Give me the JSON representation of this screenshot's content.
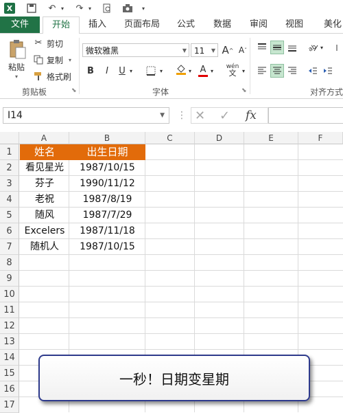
{
  "app": {
    "logo_letter": "X"
  },
  "tabs": [
    "文件",
    "开始",
    "插入",
    "页面布局",
    "公式",
    "数据",
    "审阅",
    "视图",
    "美化"
  ],
  "ribbon": {
    "clipboard": {
      "paste": "粘贴",
      "cut": "剪切",
      "copy": "复制",
      "format_painter": "格式刷",
      "group_label": "剪贴板"
    },
    "font": {
      "font_name": "微软雅黑",
      "font_size": "11",
      "bold": "B",
      "italic": "I",
      "underline": "U",
      "grow": "A",
      "shrink": "A",
      "color_a": "A",
      "phonetic": "wén",
      "group_label": "字体"
    },
    "alignment": {
      "group_label": "对齐方式"
    }
  },
  "formula_bar": {
    "name_box": "I14",
    "fx": "fx"
  },
  "columns": [
    "A",
    "B",
    "C",
    "D",
    "E",
    "F"
  ],
  "rows": [
    "1",
    "2",
    "3",
    "4",
    "5",
    "6",
    "7",
    "8",
    "9",
    "10",
    "11",
    "12",
    "13",
    "14",
    "15",
    "16",
    "17"
  ],
  "table": {
    "headers": [
      "姓名",
      "出生日期"
    ],
    "rows": [
      [
        "看见星光",
        "1987/10/15"
      ],
      [
        "芬子",
        "1990/11/12"
      ],
      [
        "老祝",
        "1987/8/19"
      ],
      [
        "随风",
        "1987/7/29"
      ],
      [
        "Excelers",
        "1987/11/18"
      ],
      [
        "随机人",
        "1987/10/15"
      ]
    ]
  },
  "callout": "一秒！日期变星期",
  "colors": {
    "excel_green": "#217346",
    "header_orange": "#e26b0a",
    "callout_border": "#2e3a8c"
  }
}
